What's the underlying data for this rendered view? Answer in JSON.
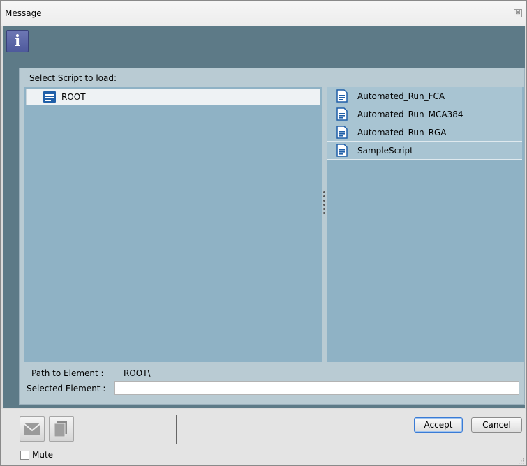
{
  "window": {
    "title": "Message",
    "close_glyph": "⊠"
  },
  "info_icon": {
    "glyph": "i",
    "name": "info-icon"
  },
  "panel": {
    "heading": "Select Script to load:",
    "tree": {
      "root_label": "ROOT",
      "icon": "folder-list-icon"
    },
    "files": [
      {
        "label": "Automated_Run_FCA",
        "icon": "document-icon"
      },
      {
        "label": "Automated_Run_MCA384",
        "icon": "document-icon"
      },
      {
        "label": "Automated_Run_RGA",
        "icon": "document-icon"
      },
      {
        "label": "SampleScript",
        "icon": "document-icon"
      }
    ],
    "path_label": "Path to Element :",
    "path_value": "ROOT\\",
    "selected_label": "Selected Element :",
    "selected_value": ""
  },
  "footer": {
    "mail_icon": "mail-icon",
    "copy_icon": "copy-icon",
    "mute_label": "Mute",
    "mute_checked": false,
    "accept_label": "Accept",
    "cancel_label": "Cancel"
  },
  "colors": {
    "content_bg": "#5d7a87",
    "pane_bg": "#8fb2c5",
    "file_row_bg": "#a8c4d2",
    "icon_blue": "#1f5fa8"
  }
}
